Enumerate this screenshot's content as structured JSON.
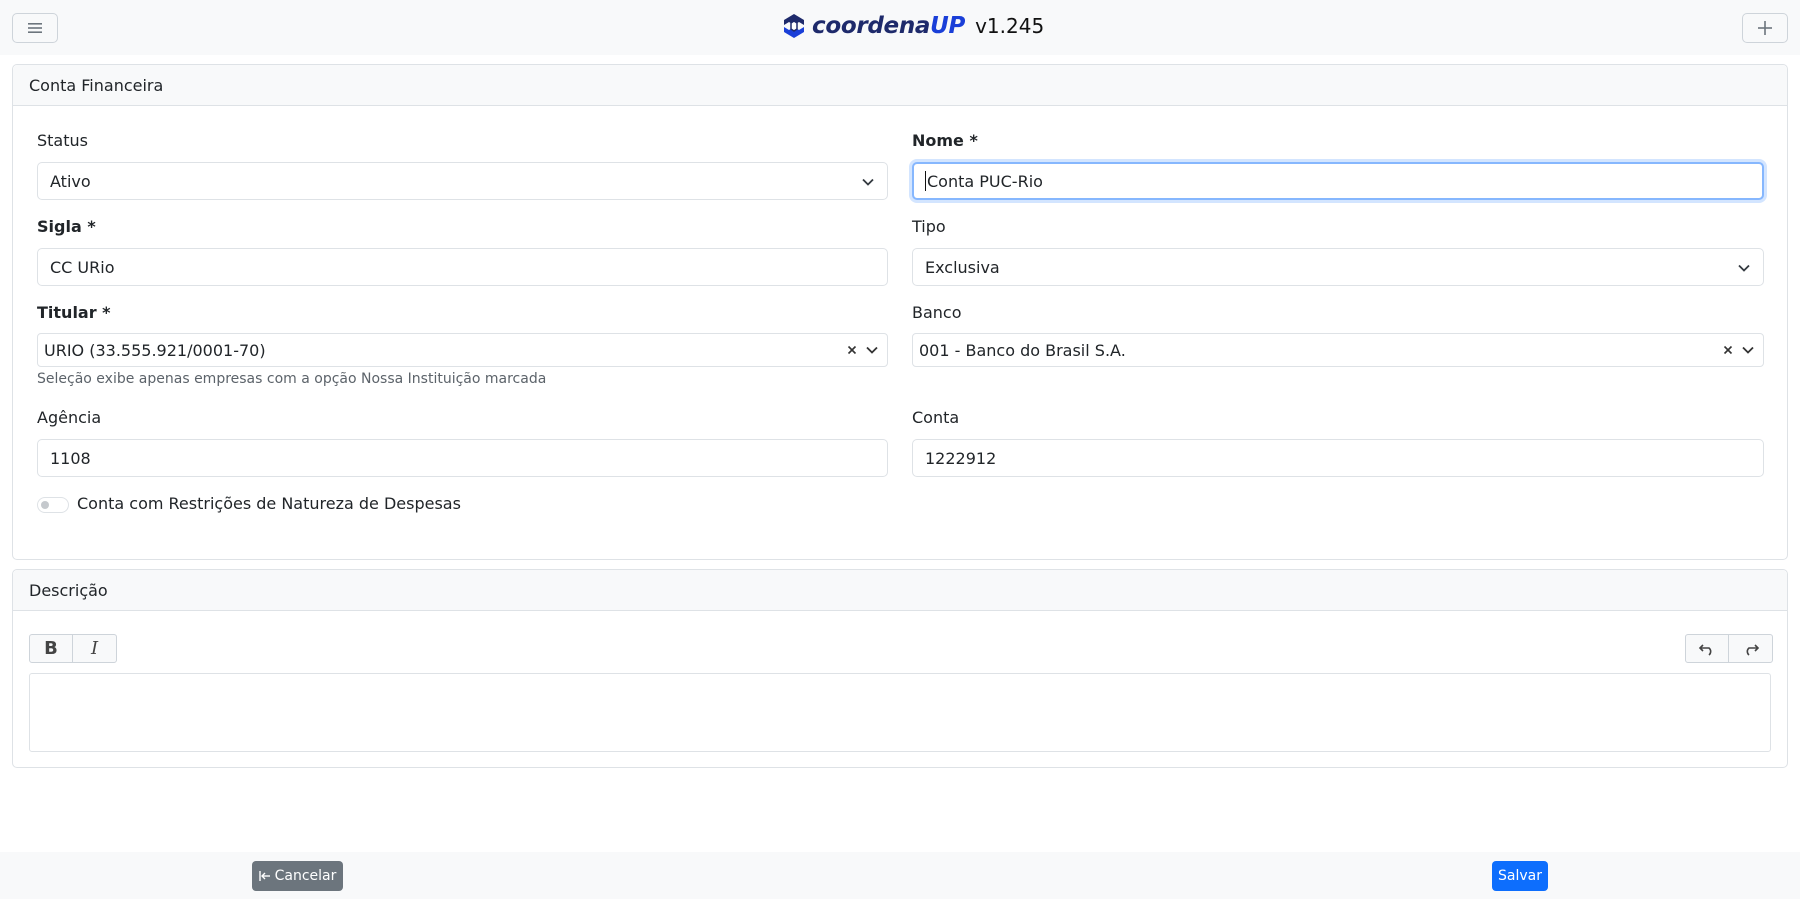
{
  "header": {
    "brand_prefix": "coordena",
    "brand_suffix": "UP",
    "version": "v1.245",
    "menu_icon": "hamburger-icon",
    "add_icon": "plus-icon"
  },
  "account_card": {
    "title": "Conta Financeira",
    "status": {
      "label": "Status",
      "value": "Ativo"
    },
    "nome": {
      "label": "Nome *",
      "value": "Conta PUC-Rio"
    },
    "sigla": {
      "label": "Sigla *",
      "value": "CC URio"
    },
    "tipo": {
      "label": "Tipo",
      "value": "Exclusiva"
    },
    "titular": {
      "label": "Titular *",
      "value": "URIO (33.555.921/0001-70)",
      "help": "Seleção exibe apenas empresas com a opção Nossa Instituição marcada"
    },
    "banco": {
      "label": "Banco",
      "value": "001 - Banco do Brasil S.A."
    },
    "agencia": {
      "label": "Agência",
      "value": "1108"
    },
    "conta": {
      "label": "Conta",
      "value": "1222912"
    },
    "restricoes": {
      "label": "Conta com Restrições de Natureza de Despesas",
      "checked": false
    }
  },
  "description_card": {
    "title": "Descrição",
    "toolbar": [
      "bold-icon",
      "italic-icon",
      "undo-icon",
      "redo-icon"
    ]
  },
  "footer": {
    "cancel_label": "Cancelar",
    "save_label": "Salvar"
  },
  "colors": {
    "primary": "#0d6efd",
    "secondary": "#6c757d",
    "brand_dark": "#1e2a6b",
    "brand_blue": "#1a3fd8"
  }
}
